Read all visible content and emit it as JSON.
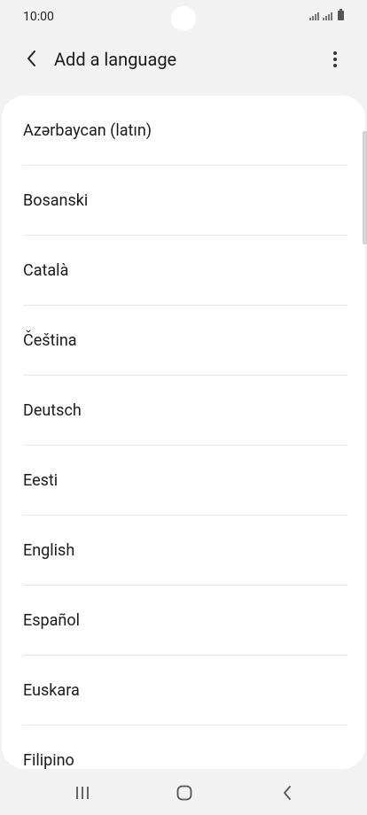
{
  "status_bar": {
    "time": "10:00"
  },
  "header": {
    "title": "Add a language",
    "back_icon": "chevron-left-icon",
    "menu_icon": "more-vertical-icon"
  },
  "languages": [
    "Azərbaycan (latın)",
    "Bosanski",
    "Català",
    "Čeština",
    "Deutsch",
    "Eesti",
    "English",
    "Español",
    "Euskara",
    "Filipino"
  ],
  "nav_bar": {
    "recents_icon": "recents-icon",
    "home_icon": "home-icon",
    "back_icon": "back-icon"
  },
  "colors": {
    "background": "#f2f2f2",
    "card": "#ffffff",
    "divider": "#e6e6e6",
    "text": "#1b1b1b"
  }
}
